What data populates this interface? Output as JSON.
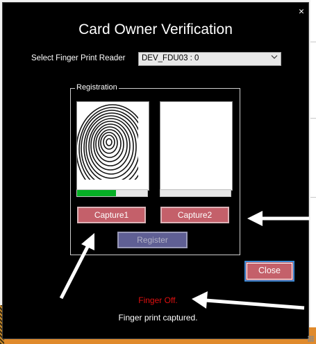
{
  "dialog": {
    "title": "Card Owner Verification",
    "close_glyph": "×"
  },
  "reader": {
    "label": "Select Finger Print Reader",
    "selected": "DEV_FDU03 : 0",
    "dropdown_icon": "chevron-down-icon"
  },
  "registration": {
    "group_label": "Registration",
    "capture1": {
      "label": "Capture1",
      "progress": 0.55,
      "has_image": true
    },
    "capture2": {
      "label": "Capture2",
      "progress": 0.0,
      "has_image": false
    },
    "register_label": "Register"
  },
  "buttons": {
    "close_label": "Close"
  },
  "status": {
    "finger": "Finger Off.",
    "message": "Finger print captured."
  },
  "colors": {
    "capture_button": "#c4606a",
    "register_button": "#5f5f94",
    "progress_fill": "#06b025",
    "finger_status": "#e01010",
    "annotation_arrow": "#ffffff"
  }
}
